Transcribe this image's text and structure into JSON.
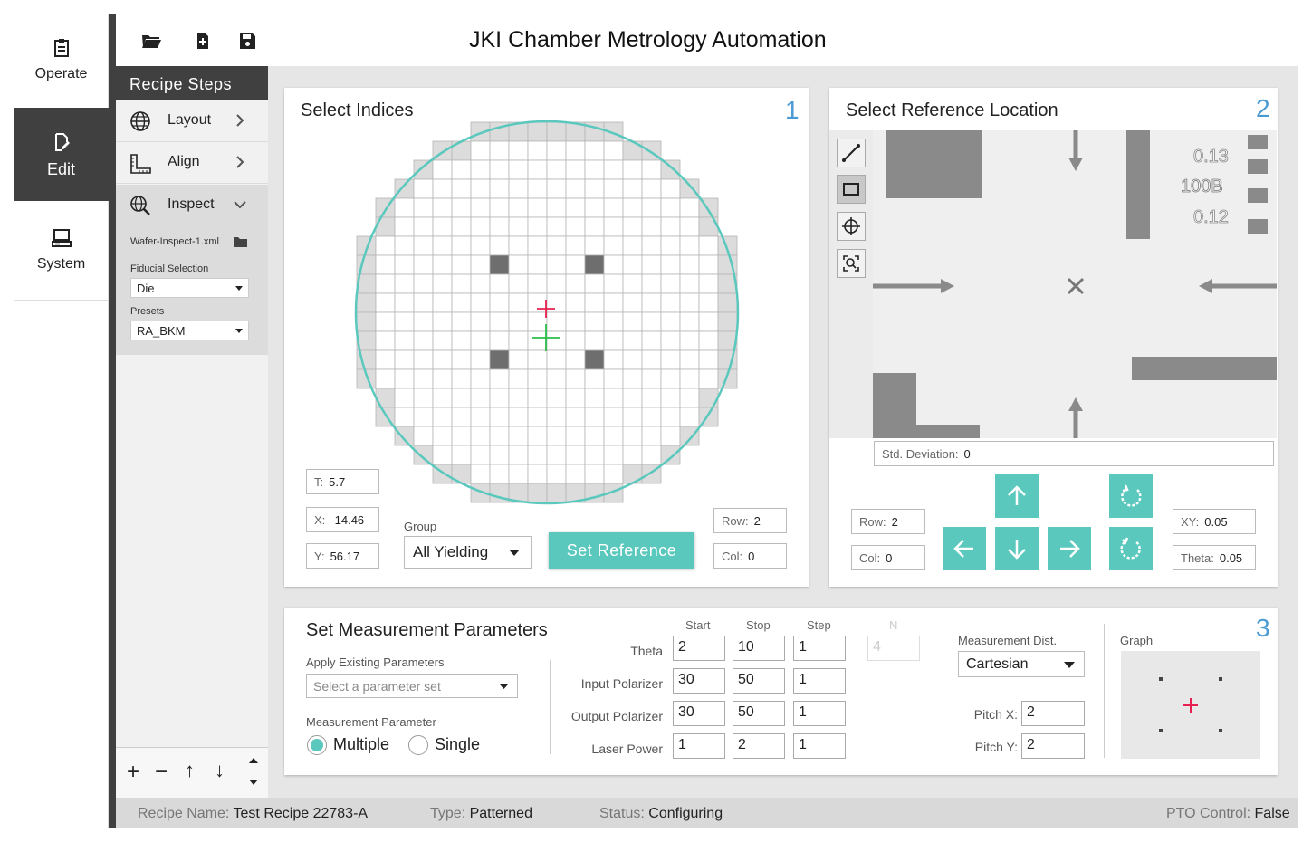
{
  "app": {
    "title": "JKI Chamber Metrology Automation"
  },
  "nav": [
    {
      "label": "Operate",
      "icon": "clipboard-icon",
      "active": false
    },
    {
      "label": "Edit",
      "icon": "edit-document-icon",
      "active": true
    },
    {
      "label": "System",
      "icon": "computer-icon",
      "active": false
    }
  ],
  "toolbar": {
    "open_icon": "folder-open-icon",
    "new_icon": "new-file-icon",
    "save_icon": "save-icon"
  },
  "recipe_steps": {
    "header": "Recipe Steps",
    "items": [
      {
        "label": "Layout",
        "icon": "globe-icon",
        "expanded": false
      },
      {
        "label": "Align",
        "icon": "ruler-icon",
        "expanded": false
      },
      {
        "label": "Inspect",
        "icon": "globe-search-icon",
        "expanded": true
      }
    ],
    "inspect": {
      "file": "Wafer-Inspect-1.xml",
      "fiducial_label": "Fiducial Selection",
      "fiducial_value": "Die",
      "presets_label": "Presets",
      "presets_value": "RA_BKM"
    },
    "bottom_controls": [
      "+",
      "−",
      "↑",
      "↓",
      "⇕"
    ]
  },
  "select_indices": {
    "title": "Select Indices",
    "number": "1",
    "T_label": "T:",
    "T_value": "5.7",
    "X_label": "X:",
    "X_value": "-14.46",
    "Y_label": "Y:",
    "Y_value": "56.17",
    "group_label": "Group",
    "group_value": "All Yielding",
    "set_reference": "Set Reference",
    "row_label": "Row:",
    "row_value": "2",
    "col_label": "Col:",
    "col_value": "0",
    "wafer_circle_color": "#5ac8bd"
  },
  "reference_location": {
    "title": "Select Reference Location",
    "number": "2",
    "tools": [
      "line-tool-icon",
      "rectangle-tool-icon",
      "crosshair-tool-icon",
      "zoom-fit-icon"
    ],
    "image_labels": [
      "0.13",
      "100B",
      "0.12"
    ],
    "std_dev_label": "Std. Deviation:",
    "std_dev_value": "0",
    "row_label": "Row:",
    "row_value": "2",
    "col_label": "Col:",
    "col_value": "0",
    "xy_label": "XY:",
    "xy_value": "0.05",
    "theta_label": "Theta:",
    "theta_value": "0.05"
  },
  "measurement": {
    "title": "Set Measurement Parameters",
    "number": "3",
    "apply_label": "Apply Existing Parameters",
    "apply_placeholder": "Select a parameter set",
    "param_label": "Measurement Parameter",
    "radio_multiple": "Multiple",
    "radio_single": "Single",
    "selected": "Multiple",
    "col_start": "Start",
    "col_stop": "Stop",
    "col_step": "Step",
    "col_n": "N",
    "rows": [
      {
        "label": "Theta",
        "start": "2",
        "stop": "10",
        "step": "1"
      },
      {
        "label": "Input Polarizer",
        "start": "30",
        "stop": "50",
        "step": "1"
      },
      {
        "label": "Output Polarizer",
        "start": "30",
        "stop": "50",
        "step": "1"
      },
      {
        "label": "Laser Power",
        "start": "1",
        "stop": "2",
        "step": "1"
      }
    ],
    "n_value": "4",
    "dist_label": "Measurement Dist.",
    "dist_value": "Cartesian",
    "pitch_x_label": "Pitch X:",
    "pitch_x_value": "2",
    "pitch_y_label": "Pitch Y:",
    "pitch_y_value": "2",
    "graph_label": "Graph"
  },
  "status": {
    "recipe_label": "Recipe Name:",
    "recipe_value": "Test Recipe 22783-A",
    "type_label": "Type:",
    "type_value": "Patterned",
    "status_label": "Status:",
    "status_value": "Configuring",
    "pto_label": "PTO Control:",
    "pto_value": "False"
  },
  "colors": {
    "teal": "#5ac8bd",
    "dark": "#404040",
    "accent_blue": "#4a9ad4",
    "crosshair_red": "#e8204f",
    "crosshair_green": "#2bbf4a"
  }
}
